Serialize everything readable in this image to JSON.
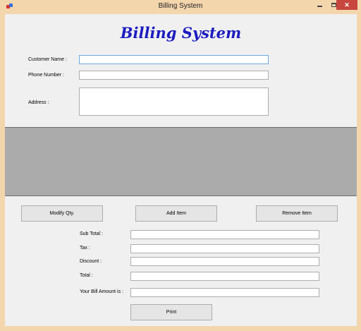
{
  "window": {
    "title": "Billing System",
    "icon": "app-icon",
    "controls": {
      "minimize": "minimize-icon",
      "maximize": "maximize-icon",
      "close": "✕"
    }
  },
  "heading": "Billing System",
  "customer": {
    "name_label": "Customer Name :",
    "name_value": "",
    "phone_label": "Phone Number :",
    "phone_value": "",
    "address_label": "Address :",
    "address_value": ""
  },
  "actions": {
    "modify": "Modify Qty.",
    "add": "Add Item",
    "remove": "Remove Item"
  },
  "summary": {
    "subtotal_label": "Sub Total :",
    "subtotal_value": "",
    "tax_label": "Tax :",
    "tax_value": "",
    "discount_label": "Discount :",
    "discount_value": "",
    "total_label": "Total :",
    "total_value": "",
    "bill_label": "Your Bill Amount is :",
    "bill_value": ""
  },
  "print": "Print",
  "colors": {
    "title_bar": "#f4d6ad",
    "heading": "#1c1cc0",
    "grid_background": "#ababab",
    "close_button": "#c7463e"
  }
}
